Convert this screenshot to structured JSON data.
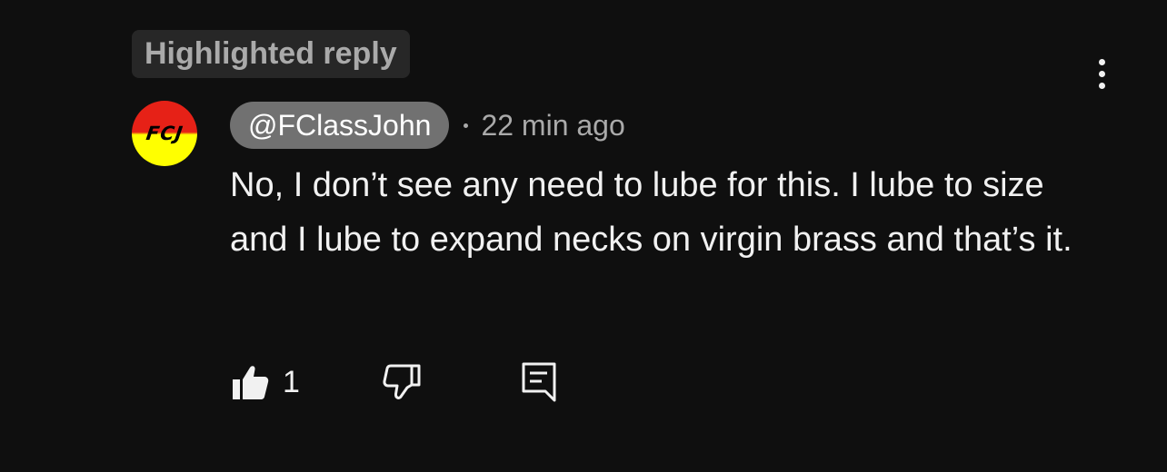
{
  "highlight": {
    "label": "Highlighted reply"
  },
  "comment": {
    "author": "@FClassJohn",
    "avatar_initials": "FCJ",
    "avatar_colors": {
      "top": "#e62117",
      "bottom": "#ffff00"
    },
    "time": "22 min ago",
    "text": "No, I don’t see any need to lube for this. I lube to size and I lube to expand necks on virgin brass and that’s it.",
    "like_count": "1"
  },
  "icons": {
    "more": "more-vertical-icon",
    "like": "thumbs-up-icon",
    "dislike": "thumbs-down-icon",
    "reply": "reply-comment-icon"
  },
  "colors": {
    "background": "#0f0f0f",
    "text": "#f1f1f1",
    "secondary_text": "#aaaaaa",
    "badge_bg": "#272727",
    "author_chip_bg": "#717171"
  }
}
